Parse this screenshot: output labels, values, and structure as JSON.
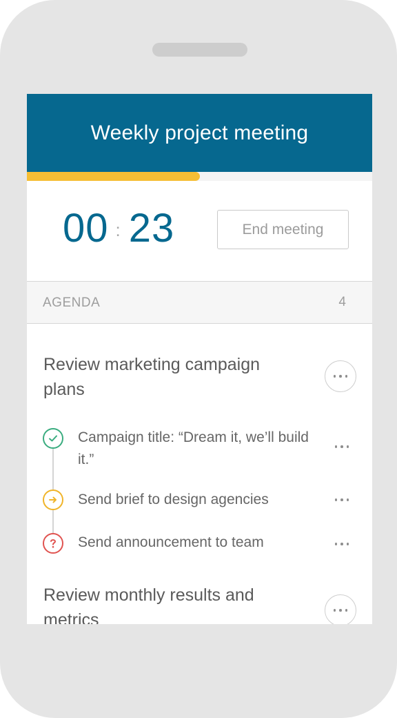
{
  "header": {
    "title": "Weekly project meeting",
    "progress_fraction": 0.5
  },
  "timer": {
    "minutes": "00",
    "separator": ":",
    "seconds": "23"
  },
  "actions": {
    "end_meeting": "End meeting"
  },
  "agenda": {
    "label": "AGENDA",
    "count": "4",
    "items": [
      {
        "title": "Review marketing campaign plans",
        "subitems": [
          {
            "text": "Campaign title: “Dream it, we’ll build it.”",
            "status": "done",
            "icon": "check-icon",
            "color": "#3aac7f"
          },
          {
            "text": "Send brief to design agencies",
            "status": "in-progress",
            "icon": "arrow-right-icon",
            "color": "#f0b429"
          },
          {
            "text": "Send announcement to team",
            "status": "question",
            "icon": "question-icon",
            "color": "#e05350"
          }
        ]
      },
      {
        "title": "Review monthly results and metrics",
        "subitems": []
      }
    ]
  },
  "colors": {
    "brand": "#06688f",
    "progress": "#f6be34",
    "phone_frame": "#e5e5e5"
  }
}
